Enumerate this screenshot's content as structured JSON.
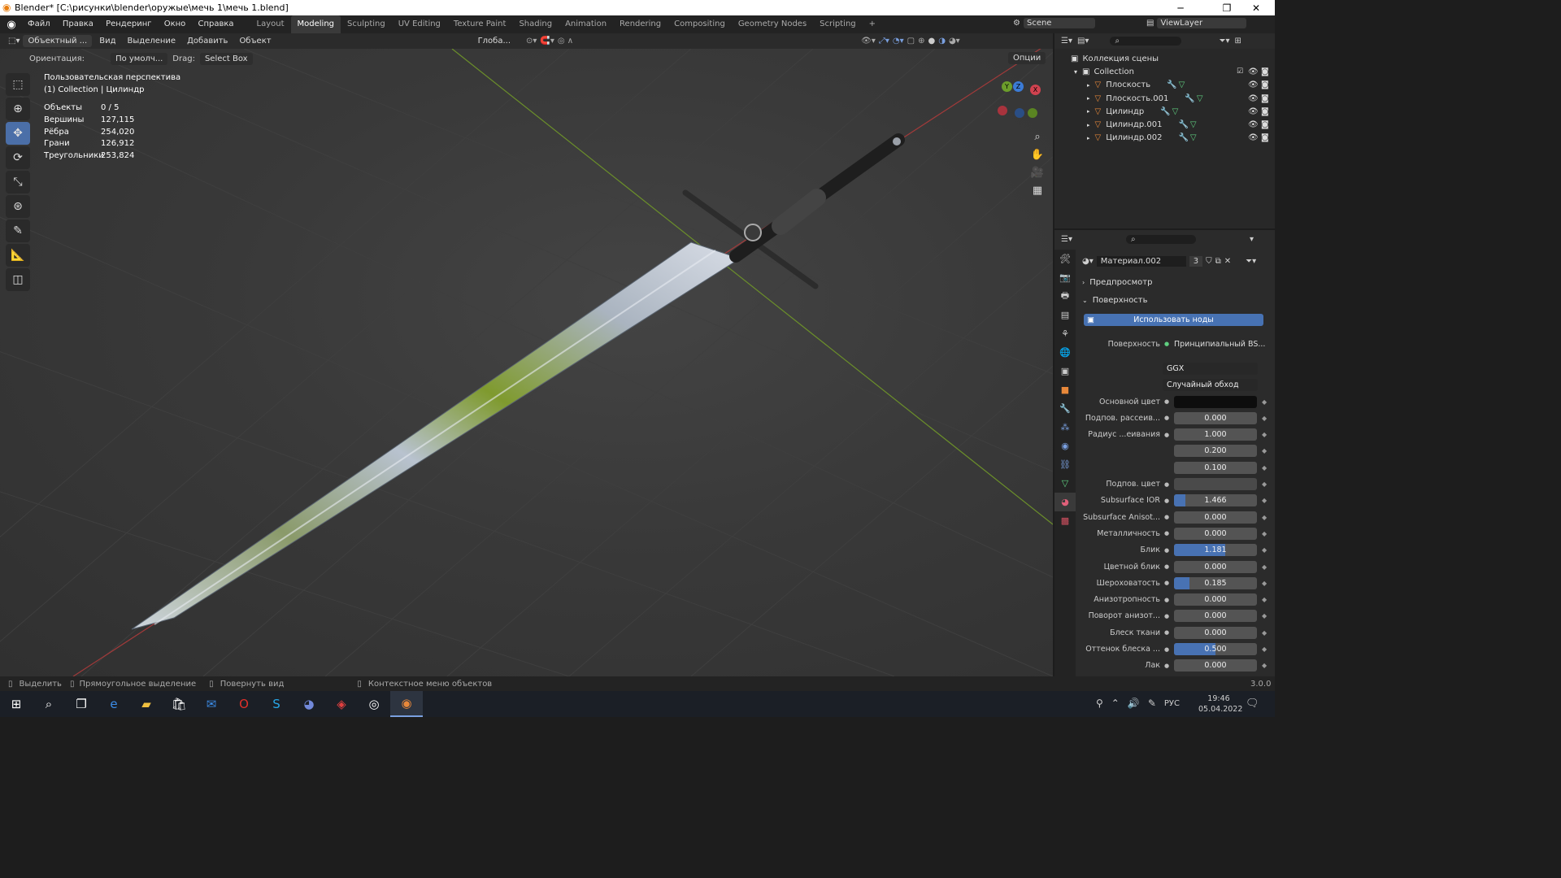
{
  "window": {
    "title": "Blender* [C:\\рисунки\\blender\\оружыe\\мечь 1\\мечь 1.blend]",
    "min": "─",
    "max": "❐",
    "close": "✕"
  },
  "menu": [
    "Файл",
    "Правка",
    "Рендеринг",
    "Окно",
    "Справка"
  ],
  "workspaces": [
    "Layout",
    "Modeling",
    "Sculpting",
    "UV Editing",
    "Texture Paint",
    "Shading",
    "Animation",
    "Rendering",
    "Compositing",
    "Geometry Nodes",
    "Scripting"
  ],
  "add_workspace": "+",
  "scene": "Scene",
  "view_layer": "ViewLayer",
  "viewport_header": {
    "mode": "Объектный ...",
    "items": [
      "Вид",
      "Выделение",
      "Добавить",
      "Объект"
    ],
    "transform": "Глоба...",
    "options": "Опции"
  },
  "tool_settings": {
    "orientation_label": "Ориентация:",
    "orientation_value": "По умолч...",
    "drag_label": "Drag:",
    "drag_value": "Select Box"
  },
  "viewport": {
    "view_name": "Пользовательская перспектива",
    "collection_line": "(1) Collection | Цилиндр",
    "stats": [
      {
        "label": "Объекты",
        "value": "0 / 5"
      },
      {
        "label": "Вершины",
        "value": "127,115"
      },
      {
        "label": "Рёбра",
        "value": "254,020"
      },
      {
        "label": "Грани",
        "value": "126,912"
      },
      {
        "label": "Треугольники",
        "value": "253,824"
      }
    ]
  },
  "gizmo": {
    "x": "X",
    "y": "Y",
    "z": "Z"
  },
  "outliner": {
    "scene_collection": "Коллекция сцены",
    "collection": "Collection",
    "objects": [
      "Плоскость",
      "Плоскость.001",
      "Цилиндр",
      "Цилиндр.001",
      "Цилиндр.002"
    ]
  },
  "properties": {
    "material_name": "Материал.002",
    "material_users": "3",
    "preview_section": "Предпросмотр",
    "surface_section": "Поверхность",
    "use_nodes": "Использовать ноды",
    "surface_label": "Поверхность",
    "surface_value": "Принципиальный BS...",
    "distribution": "GGX",
    "subsurface_method": "Случайный обход",
    "rows": [
      {
        "label": "Основной цвет",
        "value": "",
        "color": "#0d0d0d"
      },
      {
        "label": "Подпов. рассеив...",
        "value": "0.000",
        "fill": 0
      },
      {
        "label": "Радиус ...еивания",
        "value": "1.000",
        "fill": 0
      },
      {
        "label": "",
        "value": "0.200",
        "fill": 0
      },
      {
        "label": "",
        "value": "0.100",
        "fill": 0
      },
      {
        "label": "Подпов. цвет",
        "value": "",
        "color": "#4a4a4a"
      },
      {
        "label": "Subsurface IOR",
        "value": "1.466",
        "fill": 0.14
      },
      {
        "label": "Subsurface Anisot...",
        "value": "0.000",
        "fill": 0
      },
      {
        "label": "Металличность",
        "value": "0.000",
        "fill": 0
      },
      {
        "label": "Блик",
        "value": "1.181",
        "fill": 0.62
      },
      {
        "label": "Цветной блик",
        "value": "0.000",
        "fill": 0
      },
      {
        "label": "Шероховатость",
        "value": "0.185",
        "fill": 0.185
      },
      {
        "label": "Анизотропность",
        "value": "0.000",
        "fill": 0
      },
      {
        "label": "Поворот анизот...",
        "value": "0.000",
        "fill": 0
      },
      {
        "label": "Блеск ткани",
        "value": "0.000",
        "fill": 0
      },
      {
        "label": "Оттенок блеска ...",
        "value": "0.500",
        "fill": 0.5
      },
      {
        "label": "Лак",
        "value": "0.000",
        "fill": 0
      }
    ]
  },
  "statusbar": {
    "select": "Выделить",
    "box_select": "Прямоугольное выделение",
    "rotate_view": "Повернуть вид",
    "context_menu": "Контекстное меню объектов",
    "version": "3.0.0"
  },
  "taskbar": {
    "time": "19:46",
    "date": "05.04.2022",
    "lang": "РУС"
  }
}
